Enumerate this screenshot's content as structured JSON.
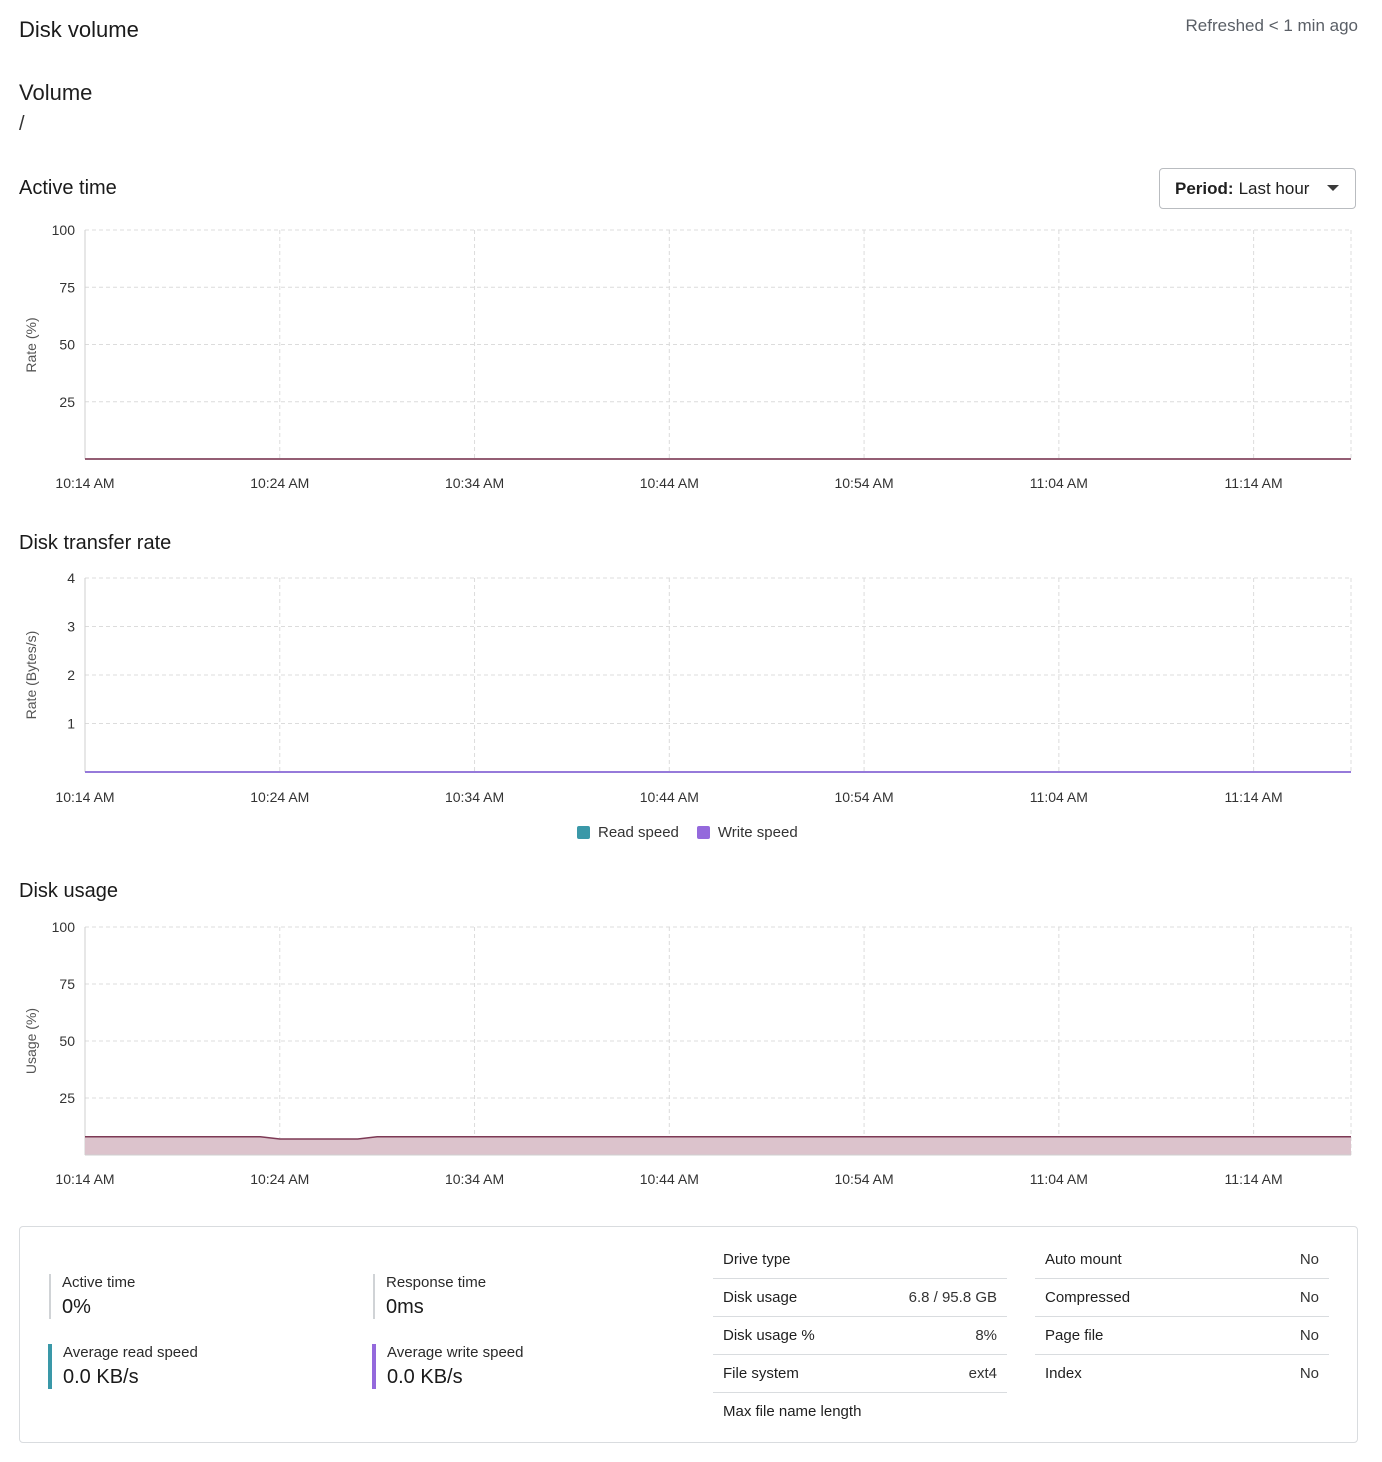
{
  "header": {
    "title": "Disk volume",
    "refreshed": "Refreshed < 1 min ago"
  },
  "volume": {
    "label": "Volume",
    "value": "/"
  },
  "period": {
    "label": "Period:",
    "value": "Last hour"
  },
  "sections": {
    "active_time": "Active time",
    "transfer_rate": "Disk transfer rate",
    "disk_usage": "Disk usage"
  },
  "colors": {
    "read": "#3a98a8",
    "write": "#9469dc",
    "usage_line": "#7d3a55",
    "usage_fill": "#dcc3cc",
    "grid": "#dcdcdc"
  },
  "chart_data": [
    {
      "type": "line",
      "ylabel": "Rate (%)",
      "ylim": [
        0,
        100
      ],
      "y_ticks": [
        "100",
        "75",
        "50",
        "25"
      ],
      "x_ticks": [
        "10:14 AM",
        "10:24 AM",
        "10:34 AM",
        "10:44 AM",
        "10:54 AM",
        "11:04 AM",
        "11:14 AM"
      ],
      "x": [
        0,
        65
      ],
      "series": [
        {
          "values": [
            0,
            0
          ]
        }
      ],
      "grid": true
    },
    {
      "type": "line",
      "ylabel": "Rate (Bytes/s)",
      "ylim": [
        0,
        4
      ],
      "y_ticks": [
        "4",
        "3",
        "2",
        "1"
      ],
      "x_ticks": [
        "10:14 AM",
        "10:24 AM",
        "10:34 AM",
        "10:44 AM",
        "10:54 AM",
        "11:04 AM",
        "11:14 AM"
      ],
      "x": [
        0,
        65
      ],
      "series": [
        {
          "name": "Read speed",
          "values": [
            0,
            0
          ]
        },
        {
          "name": "Write speed",
          "values": [
            0,
            0
          ]
        }
      ],
      "legend": "bottom",
      "grid": true
    },
    {
      "type": "area",
      "ylabel": "Usage (%)",
      "ylim": [
        0,
        100
      ],
      "y_ticks": [
        "100",
        "75",
        "50",
        "25"
      ],
      "x_ticks": [
        "10:14 AM",
        "10:24 AM",
        "10:34 AM",
        "10:44 AM",
        "10:54 AM",
        "11:04 AM",
        "11:14 AM"
      ],
      "x": [
        0,
        9,
        10,
        14,
        15,
        65
      ],
      "series": [
        {
          "values": [
            8,
            8,
            7,
            7,
            8,
            8
          ]
        }
      ],
      "grid": true
    }
  ],
  "stats": {
    "active_time": {
      "label": "Active time",
      "value": "0%"
    },
    "response_time": {
      "label": "Response time",
      "value": "0ms"
    },
    "avg_read": {
      "label": "Average read speed",
      "value": "0.0 KB/s"
    },
    "avg_write": {
      "label": "Average write speed",
      "value": "0.0 KB/s"
    }
  },
  "details_left": [
    {
      "key": "Drive type",
      "value": ""
    },
    {
      "key": "Disk usage",
      "value": "6.8 / 95.8 GB"
    },
    {
      "key": "Disk usage %",
      "value": "8%"
    },
    {
      "key": "File system",
      "value": "ext4"
    },
    {
      "key": "Max file name length",
      "value": ""
    }
  ],
  "details_right": [
    {
      "key": "Auto mount",
      "value": "No"
    },
    {
      "key": "Compressed",
      "value": "No"
    },
    {
      "key": "Page file",
      "value": "No"
    },
    {
      "key": "Index",
      "value": "No"
    }
  ]
}
